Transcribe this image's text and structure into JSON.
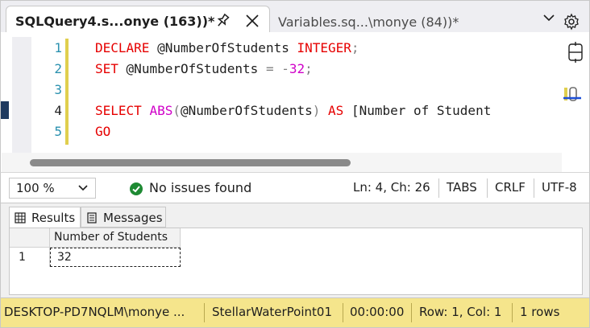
{
  "tabs": {
    "active": {
      "title": "SQLQuery4.s...onye (163))*",
      "pin_icon": "pin-icon",
      "close_icon": "close-icon"
    },
    "inactive": {
      "title": "Variables.sq...\\monye (84))*"
    },
    "overflow_icon": "chevron-down-icon",
    "settings_icon": "gear-icon"
  },
  "editor": {
    "line_numbers": [
      "1",
      "2",
      "3",
      "4",
      "5"
    ],
    "current_line": 4,
    "lines": [
      {
        "kw1": "DECLARE",
        "var": "@NumberOfStudents",
        "kw2": "INTEGER",
        "end": ";"
      },
      {
        "kw1": "SET",
        "var": "@NumberOfStudents",
        "op": "=",
        "minus": "-",
        "num": "32",
        "end": ";"
      },
      {},
      {
        "kw1": "SELECT",
        "fn": "ABS",
        "open": "(",
        "var": "@NumberOfStudents",
        "close": ")",
        "kw2": "AS",
        "alias": "[Number of Student"
      },
      {
        "kw1": "GO"
      }
    ],
    "colors": {
      "keyword": "#e60000",
      "number": "#d000c8",
      "gray": "#808080",
      "line_number": "#2b91af",
      "change_bar": "#e0cf4e"
    }
  },
  "infobar": {
    "zoom": "100 %",
    "issues": "No issues found",
    "position": "Ln: 4, Ch: 26",
    "indent": "TABS",
    "line_ending": "CRLF",
    "encoding": "UTF-8"
  },
  "results": {
    "tabs": [
      "Results",
      "Messages"
    ],
    "columns": [
      "Number of Students"
    ],
    "rows": [
      {
        "num": "1",
        "values": [
          "32"
        ]
      }
    ]
  },
  "statusbar": {
    "server": "DESKTOP-PD7NQLM\\monye ...",
    "database": "StellarWaterPoint01",
    "elapsed": "00:00:00",
    "cursor": "Row: 1, Col: 1",
    "rows": "1 rows",
    "color": "#f5e58c"
  }
}
